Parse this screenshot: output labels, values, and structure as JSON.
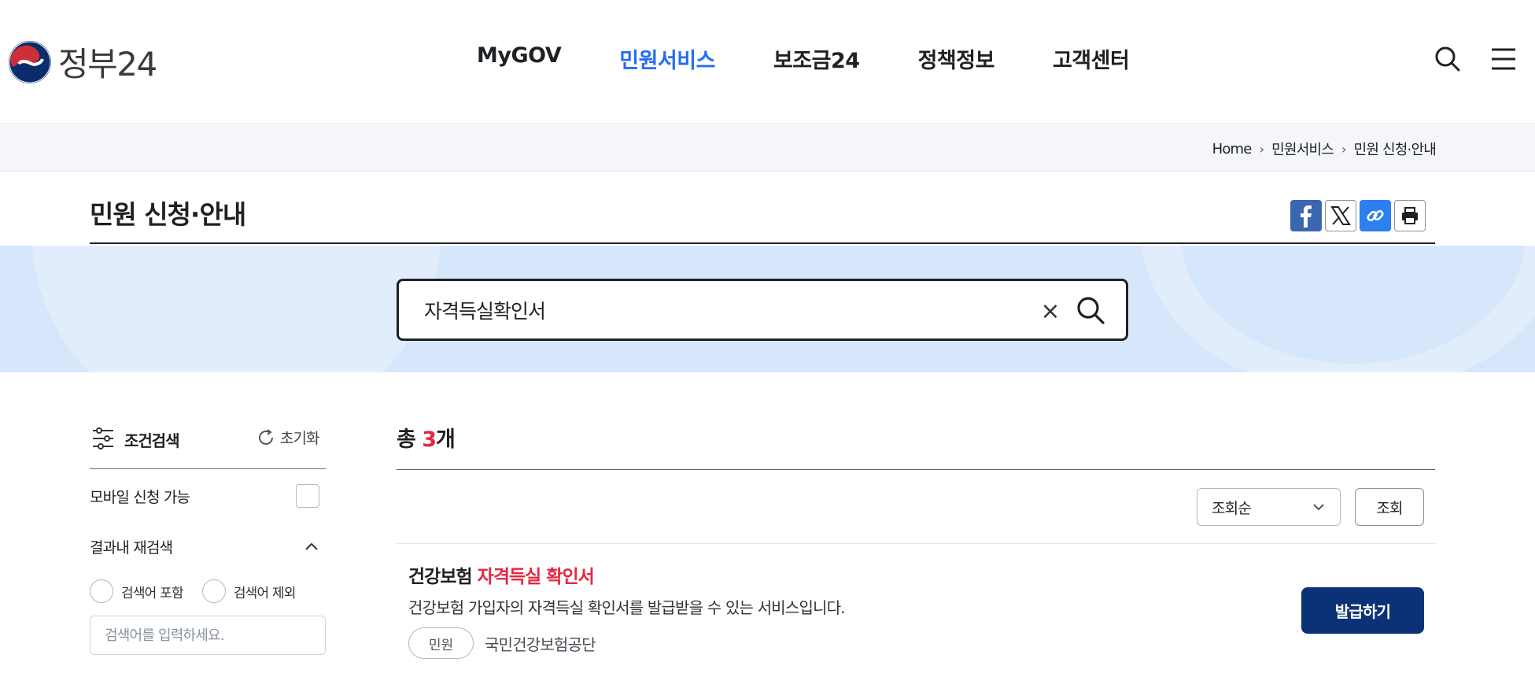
{
  "header": {
    "logo_text": "정부24",
    "nav": [
      {
        "label": "MyGOV",
        "active": false
      },
      {
        "label": "민원서비스",
        "active": true
      },
      {
        "label": "보조금24",
        "active": false
      },
      {
        "label": "정책정보",
        "active": false
      },
      {
        "label": "고객센터",
        "active": false
      }
    ],
    "icons": [
      "search-icon",
      "hamburger-menu-icon"
    ]
  },
  "breadcrumb": [
    "Home",
    "민원서비스",
    "민원 신청·안내"
  ],
  "page": {
    "title": "민원 신청·안내",
    "share_icons": [
      "facebook-icon",
      "x-icon",
      "link-icon",
      "print-icon"
    ]
  },
  "search": {
    "value": "자격득실확인서",
    "clear_symbol": "×"
  },
  "filter": {
    "title": "조건검색",
    "reset_label": "초기화",
    "mobile_label": "모바일 신청 가능",
    "mobile_checked": false,
    "research_label": "결과내 재검색",
    "radio_include": "검색어 포함",
    "radio_exclude": "검색어 제외",
    "keyword_placeholder": "검색어를 입력하세요."
  },
  "results": {
    "total_prefix": "총 ",
    "total_count": "3",
    "total_suffix": "개",
    "sort_selected": "조회순",
    "sort_button": "조회",
    "items": [
      {
        "title_prefix": "건강보험 ",
        "title_highlight": "자격득실 확인서",
        "description": "건강보험 가입자의 자격득실 확인서를 발급받을 수 있는 서비스입니다.",
        "tag": "민원",
        "org": "국민건강보험공단",
        "action": "발급하기"
      }
    ]
  },
  "colors": {
    "accent_blue": "#256ef4",
    "highlight_red": "#e5273f",
    "navy_button": "#0b3276",
    "band_blue": "#d7e7fb"
  }
}
